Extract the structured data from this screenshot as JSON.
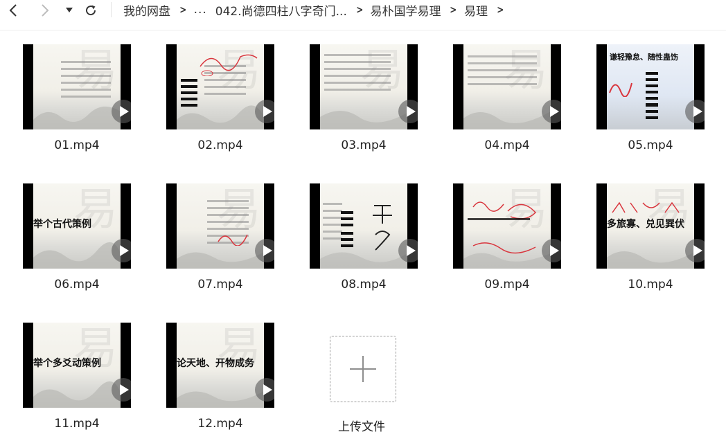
{
  "toolbar": {
    "back_icon": "chevron-left-icon",
    "forward_icon": "chevron-right-icon",
    "dropdown_icon": "caret-down-icon",
    "refresh_icon": "refresh-icon"
  },
  "breadcrumb": {
    "items": [
      "我的网盘",
      "...",
      "042.尚德四柱八字奇门...",
      "易朴国学易理",
      "易理"
    ],
    "separator": ">"
  },
  "files": [
    {
      "name": "01.mp4"
    },
    {
      "name": "02.mp4"
    },
    {
      "name": "03.mp4"
    },
    {
      "name": "04.mp4"
    },
    {
      "name": "05.mp4"
    },
    {
      "name": "06.mp4"
    },
    {
      "name": "07.mp4"
    },
    {
      "name": "08.mp4"
    },
    {
      "name": "09.mp4"
    },
    {
      "name": "10.mp4"
    },
    {
      "name": "11.mp4"
    },
    {
      "name": "12.mp4"
    }
  ],
  "slides": {
    "s05_title": "谦轻豫怠、随性蛊饬",
    "s06_title": "举个古代策例",
    "s10_title": "多旅寡、兑见巽伏",
    "s11_title": "举个多爻动策例",
    "s12_title": "论天地、开物成务"
  },
  "upload": {
    "label": "上传文件",
    "icon": "plus-icon"
  },
  "colors": {
    "thumb_bg": "#000000",
    "ink_red": "#d9363e",
    "accent_purple": "#7b3fb0"
  }
}
